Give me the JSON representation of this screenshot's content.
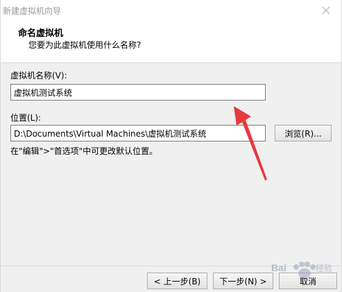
{
  "window": {
    "title": "新建虚拟机向导"
  },
  "header": {
    "title": "命名虚拟机",
    "subtitle": "您要为此虚拟机使用什么名称?"
  },
  "form": {
    "name_label": "虚拟机名称(V):",
    "name_value": "虚拟机测试系统",
    "location_label": "位置(L):",
    "location_value": "D:\\Documents\\Virtual Machines\\虚拟机测试系统",
    "browse_label": "浏览(R)...",
    "hint": "在\"编辑\">\"首选项\"中可更改默认位置。"
  },
  "footer": {
    "back_label": "< 上一步(B)",
    "next_label": "下一步(N) >",
    "cancel_label": "取消"
  },
  "annotation": {
    "arrow_color": "#e8383d"
  },
  "watermark": {
    "text": "Baidu 经验"
  }
}
